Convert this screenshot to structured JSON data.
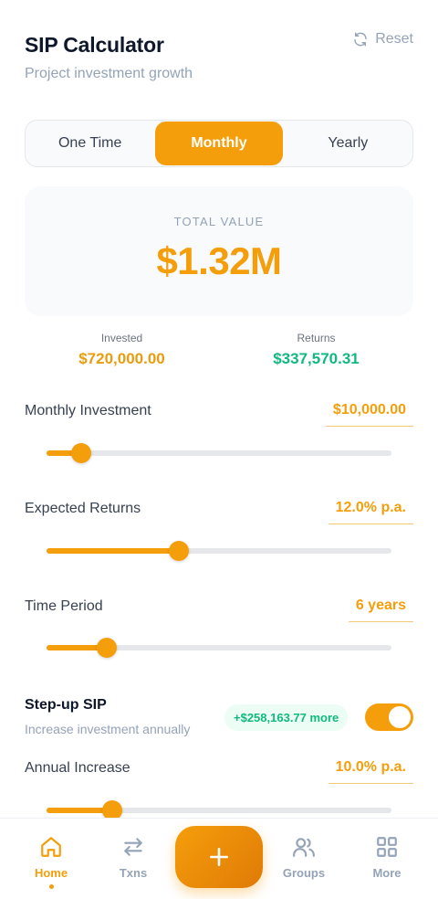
{
  "header": {
    "title": "SIP Calculator",
    "subtitle": "Project investment growth",
    "reset_label": "Reset"
  },
  "frequency_tabs": [
    {
      "label": "One Time",
      "active": false
    },
    {
      "label": "Monthly",
      "active": true
    },
    {
      "label": "Yearly",
      "active": false
    }
  ],
  "summary": {
    "total_label": "TOTAL VALUE",
    "total_value": "$1.32M",
    "invested_label": "Invested",
    "invested_value": "$720,000.00",
    "returns_label": "Returns",
    "returns_value": "$337,570.31"
  },
  "sliders": {
    "monthly_investment": {
      "label": "Monthly Investment",
      "value": "$10,000.00",
      "fraction": 0.1
    },
    "expected_returns": {
      "label": "Expected Returns",
      "value": "12.0% p.a.",
      "fraction": 0.383
    },
    "time_period": {
      "label": "Time Period",
      "value": "6 years",
      "fraction": 0.175
    },
    "annual_increase": {
      "label": "Annual Increase",
      "value": "10.0% p.a.",
      "fraction": 0.19
    }
  },
  "stepup": {
    "title": "Step-up SIP",
    "subtitle": "Increase investment annually",
    "extra_badge": "+$258,163.77 more",
    "enabled": true
  },
  "nav": {
    "items": [
      {
        "label": "Home",
        "icon": "home-icon",
        "active": true
      },
      {
        "label": "Txns",
        "icon": "transfer-icon",
        "active": false
      },
      {
        "label": "Groups",
        "icon": "users-icon",
        "active": false
      },
      {
        "label": "More",
        "icon": "grid-icon",
        "active": false
      }
    ],
    "fab_icon": "plus-icon"
  },
  "colors": {
    "accent": "#f59e0b",
    "positive": "#10b981",
    "muted": "#94a3b8"
  }
}
